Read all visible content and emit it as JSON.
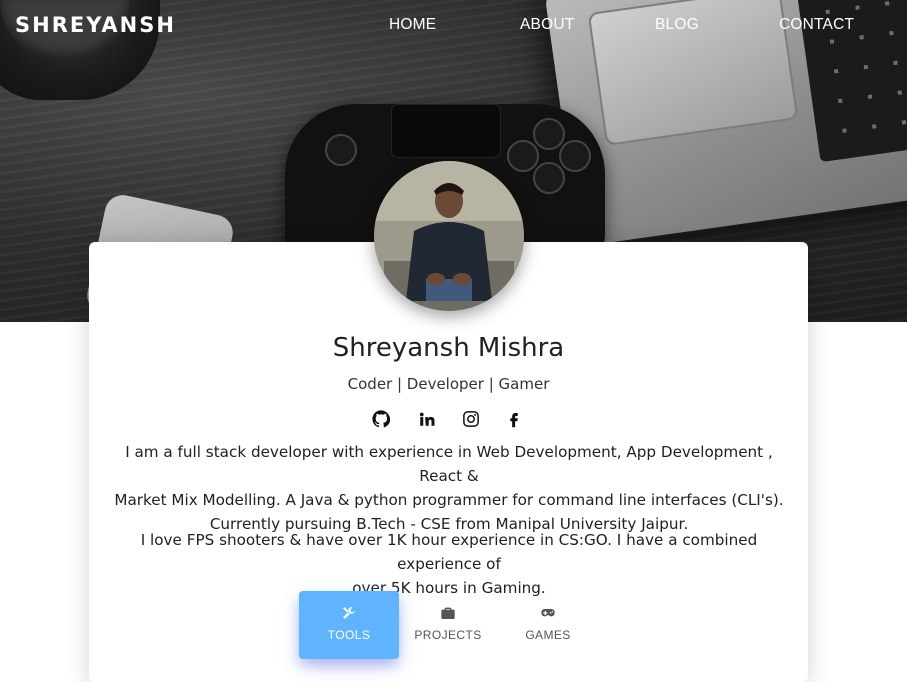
{
  "header": {
    "brand": "SHREYANSH",
    "nav": [
      {
        "label": "HOME"
      },
      {
        "label": "ABOUT"
      },
      {
        "label": "BLOG"
      },
      {
        "label": "CONTACT"
      }
    ]
  },
  "profile": {
    "name": "Shreyansh Mishra",
    "tagline": "Coder | Developer | Gamer",
    "socials": [
      {
        "icon": "github-icon"
      },
      {
        "icon": "linkedin-icon"
      },
      {
        "icon": "instagram-icon"
      },
      {
        "icon": "facebook-icon"
      }
    ],
    "bio_lines": [
      "I am a full stack developer with experience in Web Development, App Development , React &",
      "Market Mix Modelling. A Java & python programmer for command line interfaces (CLI's).",
      "Currently pursuing B.Tech - CSE from Manipal University Jaipur."
    ],
    "bio2_lines": [
      "I love FPS shooters & have over 1K hour experience in CS:GO. I have a combined experience of",
      "over 5K hours in Gaming."
    ]
  },
  "tabs": [
    {
      "label": "TOOLS",
      "icon": "tools-icon",
      "active": true
    },
    {
      "label": "PROJECTS",
      "icon": "briefcase-icon",
      "active": false
    },
    {
      "label": "GAMES",
      "icon": "gamepad-icon",
      "active": false
    }
  ],
  "colors": {
    "active_tab": "#5fb3ff",
    "text": "#212121",
    "nav_text": "#ffffff"
  }
}
